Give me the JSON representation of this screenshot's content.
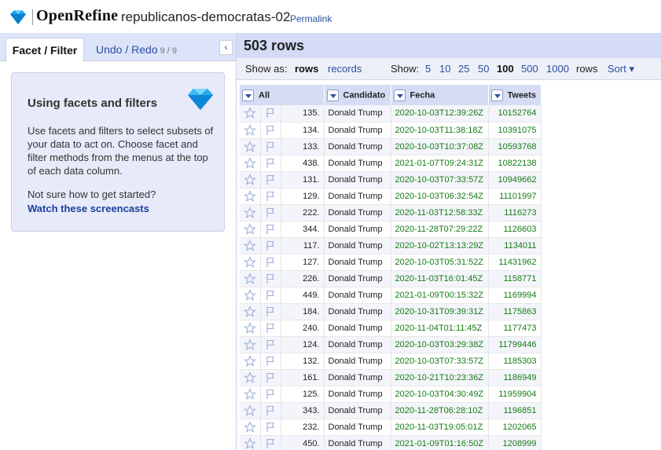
{
  "header": {
    "app_name": "OpenRefine",
    "project_name": "republicanos-democratas-02",
    "permalink": "Permalink"
  },
  "left_panel": {
    "tabs": [
      {
        "label": "Facet / Filter"
      },
      {
        "label": "Undo / Redo",
        "count": "9 / 9"
      }
    ],
    "collapse_icon": "‹",
    "help": {
      "title": "Using facets and filters",
      "body": "Use facets and filters to select subsets of your data to act on. Choose facet and filter methods from the menus at the top of each data column.",
      "question": "Not sure how to get started?",
      "link": "Watch these screencasts"
    }
  },
  "right_panel": {
    "row_count": "503 rows",
    "view": {
      "show_as_label": "Show as:",
      "rows": "rows",
      "records": "records",
      "show_label": "Show:",
      "page_sizes": [
        "5",
        "10",
        "25",
        "50",
        "100",
        "500",
        "1000"
      ],
      "selected_page_size": "100",
      "rows_suffix": "rows",
      "sort": "Sort ▾"
    },
    "columns": [
      "All",
      "Candidato",
      "Fecha",
      "Tweets"
    ],
    "rows": [
      {
        "n": "135.",
        "candidato": "Donald Trump",
        "fecha": "2020-10-03T12:39:26Z",
        "tweets": "10152764"
      },
      {
        "n": "134.",
        "candidato": "Donald Trump",
        "fecha": "2020-10-03T11:38:18Z",
        "tweets": "10391075"
      },
      {
        "n": "133.",
        "candidato": "Donald Trump",
        "fecha": "2020-10-03T10:37:08Z",
        "tweets": "10593768"
      },
      {
        "n": "438.",
        "candidato": "Donald Trump",
        "fecha": "2021-01-07T09:24:31Z",
        "tweets": "10822138"
      },
      {
        "n": "131.",
        "candidato": "Donald Trump",
        "fecha": "2020-10-03T07:33:57Z",
        "tweets": "10949662"
      },
      {
        "n": "129.",
        "candidato": "Donald Trump",
        "fecha": "2020-10-03T06:32:54Z",
        "tweets": "11101997"
      },
      {
        "n": "222.",
        "candidato": "Donald Trump",
        "fecha": "2020-11-03T12:58:33Z",
        "tweets": "1116273"
      },
      {
        "n": "344.",
        "candidato": "Donald Trump",
        "fecha": "2020-11-28T07:29:22Z",
        "tweets": "1126603"
      },
      {
        "n": "117.",
        "candidato": "Donald Trump",
        "fecha": "2020-10-02T13:13:29Z",
        "tweets": "1134011"
      },
      {
        "n": "127.",
        "candidato": "Donald Trump",
        "fecha": "2020-10-03T05:31:52Z",
        "tweets": "11431962"
      },
      {
        "n": "226.",
        "candidato": "Donald Trump",
        "fecha": "2020-11-03T16:01:45Z",
        "tweets": "1158771"
      },
      {
        "n": "449.",
        "candidato": "Donald Trump",
        "fecha": "2021-01-09T00:15:32Z",
        "tweets": "1169994"
      },
      {
        "n": "184.",
        "candidato": "Donald Trump",
        "fecha": "2020-10-31T09:39:31Z",
        "tweets": "1175863"
      },
      {
        "n": "240.",
        "candidato": "Donald Trump",
        "fecha": "2020-11-04T01:11:45Z",
        "tweets": "1177473"
      },
      {
        "n": "124.",
        "candidato": "Donald Trump",
        "fecha": "2020-10-03T03:29:38Z",
        "tweets": "11799446"
      },
      {
        "n": "132.",
        "candidato": "Donald Trump",
        "fecha": "2020-10-03T07:33:57Z",
        "tweets": "1185303"
      },
      {
        "n": "161.",
        "candidato": "Donald Trump",
        "fecha": "2020-10-21T10:23:36Z",
        "tweets": "1186949"
      },
      {
        "n": "125.",
        "candidato": "Donald Trump",
        "fecha": "2020-10-03T04:30:49Z",
        "tweets": "11959904"
      },
      {
        "n": "343.",
        "candidato": "Donald Trump",
        "fecha": "2020-11-28T06:28:10Z",
        "tweets": "1196851"
      },
      {
        "n": "232.",
        "candidato": "Donald Trump",
        "fecha": "2020-11-03T19:05:01Z",
        "tweets": "1202065"
      },
      {
        "n": "450.",
        "candidato": "Donald Trump",
        "fecha": "2021-01-09T01:16:50Z",
        "tweets": "1208999"
      }
    ]
  },
  "colors": {
    "accent": "#2a4ea0",
    "summary_bg": "#d4dbf7",
    "value_green": "#157a15",
    "gem_blue": "#1aa3f0"
  },
  "icons": {
    "logo": "diamond-logo-icon",
    "help": "diamond-icon",
    "star": "star-icon",
    "flag": "flag-icon",
    "column_menu": "dropdown-arrow-icon",
    "collapse": "chevron-left-icon"
  }
}
